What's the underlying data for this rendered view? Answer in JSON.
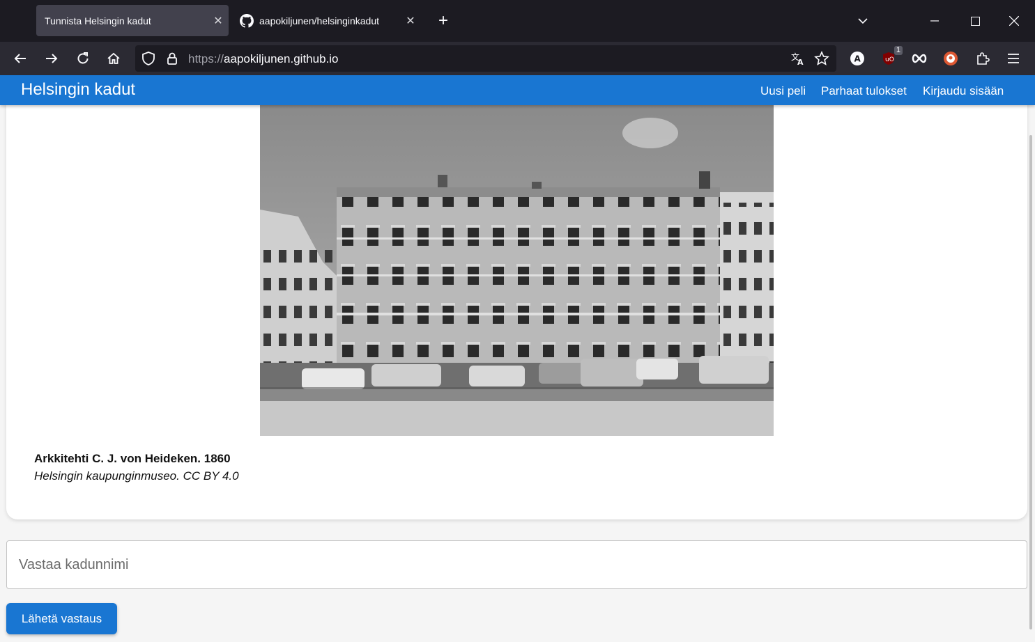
{
  "browser": {
    "tabs": [
      {
        "title": "Tunnista Helsingin kadut",
        "active": true
      },
      {
        "title": "aapokiljunen/helsinginkadut",
        "active": false
      }
    ],
    "url_protocol": "https://",
    "url_host": "aapokiljunen.github.io",
    "extension_badge": "1",
    "icons": [
      "back-icon",
      "forward-icon",
      "reload-icon",
      "home-icon",
      "shield-icon",
      "lock-icon",
      "translate-icon",
      "bookmark-star-icon",
      "account-icon",
      "ublock-icon",
      "infinity-icon",
      "duckduckgo-icon",
      "extensions-icon",
      "menu-icon"
    ]
  },
  "app": {
    "title": "Helsingin kadut",
    "nav": {
      "new_game": "Uusi peli",
      "best_scores": "Parhaat tulokset",
      "login": "Kirjaudu sisään"
    }
  },
  "photo": {
    "caption_title": "Arkkitehti C. J. von Heideken. 1860",
    "caption_credit": "Helsingin kaupunginmuseo. CC BY 4.0"
  },
  "form": {
    "answer_placeholder": "Vastaa kadunnimi",
    "submit_label": "Lähetä vastaus"
  },
  "colors": {
    "brand": "#1976d2",
    "chrome_dark": "#1c1b22",
    "chrome_toolbar": "#2b2a33"
  }
}
